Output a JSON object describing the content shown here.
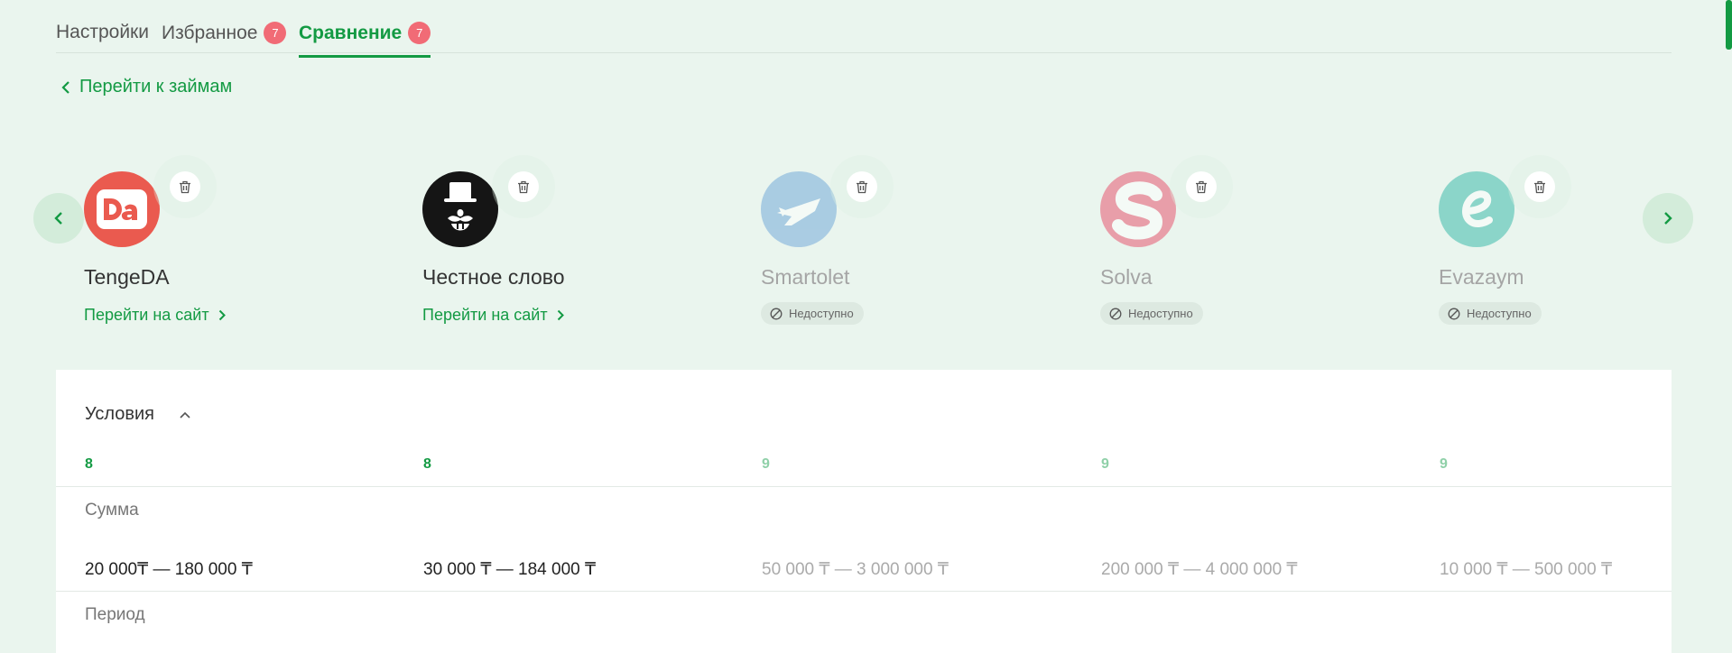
{
  "tabs": [
    {
      "label": "Настройки"
    },
    {
      "label": "Избранное",
      "count": "7"
    },
    {
      "label": "Сравнение",
      "count": "7"
    }
  ],
  "back_link": "Перейти к займам",
  "site_link_label": "Перейти на сайт",
  "unavailable_label": "Недоступно",
  "lenders": [
    {
      "name": "TengeDA",
      "available": true
    },
    {
      "name": "Честное слово",
      "available": true
    },
    {
      "name": "Smartolet",
      "available": false
    },
    {
      "name": "Solva",
      "available": false
    },
    {
      "name": "Evazaym",
      "available": false
    }
  ],
  "conditions": {
    "title": "Условия",
    "scores": [
      "8",
      "8",
      "9",
      "9",
      "9"
    ],
    "rows": [
      {
        "label": "Сумма",
        "values": [
          "20 000₸ — 180 000 ₸",
          "30 000 ₸ — 184 000 ₸",
          "50 000 ₸ — 3 000 000 ₸",
          "200 000 ₸ — 4 000 000 ₸",
          "10 000 ₸ — 500 000 ₸"
        ]
      },
      {
        "label": "Период"
      }
    ]
  },
  "colors": {
    "accent": "#139a43",
    "badge": "#f16b76",
    "background": "#eaf5ee"
  }
}
